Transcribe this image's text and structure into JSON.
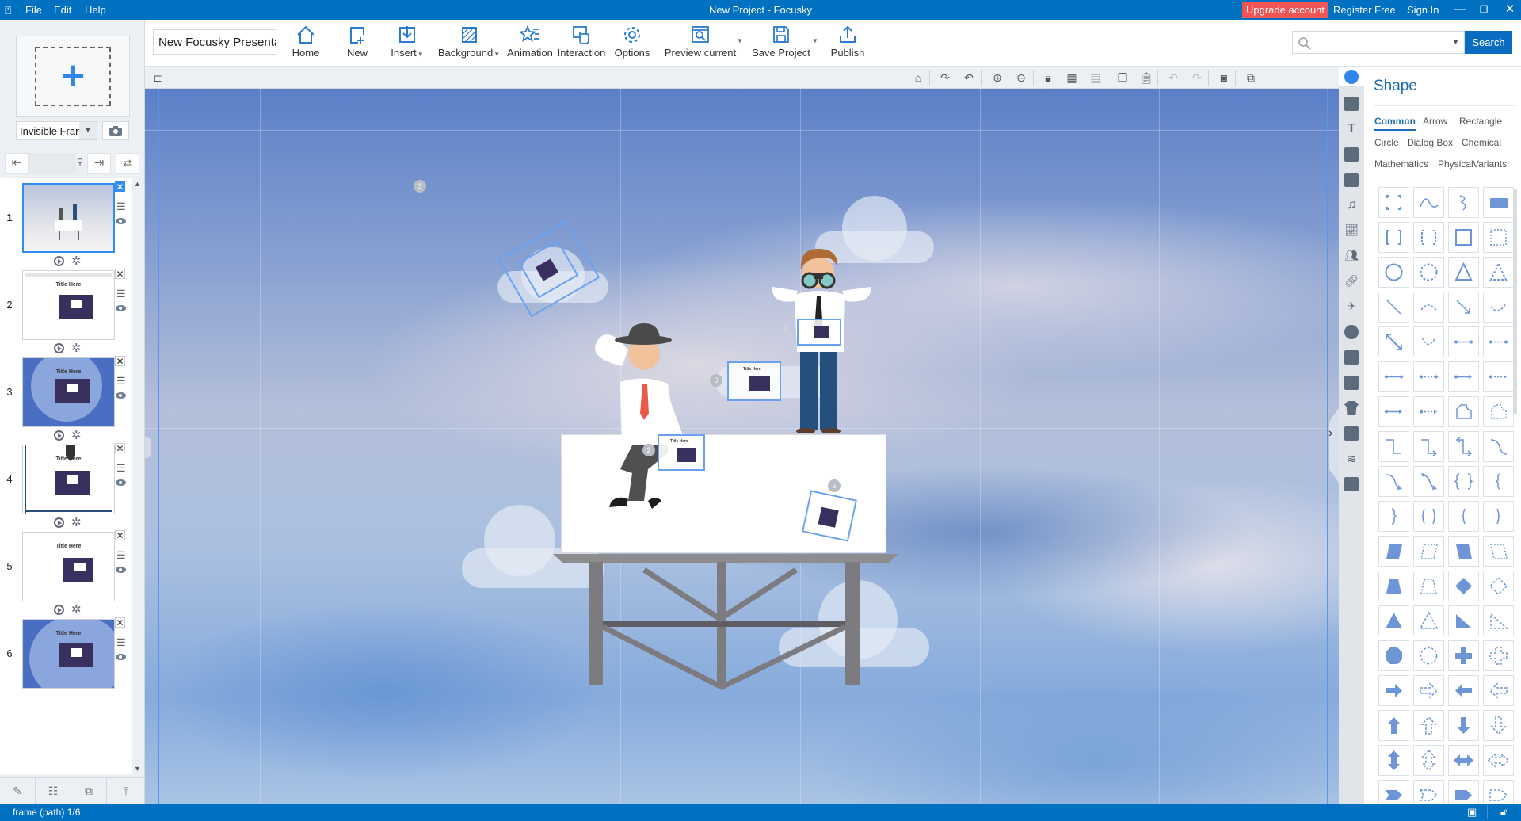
{
  "titlebar": {
    "app_icon": "presentation-icon",
    "menus": [
      "File",
      "Edit",
      "Help"
    ],
    "title": "New Project - Focusky",
    "upgrade": "Upgrade account",
    "register": "Register Free",
    "signin": "Sign In",
    "window_controls": [
      "minimize-icon",
      "restore-icon",
      "close-icon"
    ]
  },
  "toolbar": {
    "project_name": "New Focusky Presenta",
    "buttons": [
      {
        "label": "Home",
        "icon": "home-icon"
      },
      {
        "label": "New",
        "icon": "new-page-icon"
      },
      {
        "label": "Insert",
        "icon": "insert-icon",
        "dropdown": true
      },
      {
        "label": "Background",
        "icon": "background-icon",
        "dropdown": true
      },
      {
        "label": "Animation",
        "icon": "animation-star-icon"
      },
      {
        "label": "Interaction",
        "icon": "interaction-hand-icon"
      },
      {
        "label": "Options",
        "icon": "gear-icon"
      },
      {
        "label": "Preview current",
        "icon": "preview-icon",
        "dropdown": true
      },
      {
        "label": "Save Project",
        "icon": "save-icon",
        "dropdown": true
      },
      {
        "label": "Publish",
        "icon": "publish-icon"
      }
    ],
    "search_placeholder": "",
    "search_button": "Search"
  },
  "left_panel": {
    "add_frame_symbol": "+",
    "frame_type": "Invisible Fran",
    "frames": [
      {
        "number": "1",
        "title": "",
        "selected": true,
        "theme": "scene"
      },
      {
        "number": "2",
        "title": "Title Here",
        "selected": false,
        "theme": "white"
      },
      {
        "number": "3",
        "title": "Title Here",
        "selected": false,
        "theme": "blue"
      },
      {
        "number": "4",
        "title": "Title Here",
        "selected": false,
        "theme": "white-arrow"
      },
      {
        "number": "5",
        "title": "Title Here",
        "selected": false,
        "theme": "white"
      },
      {
        "number": "6",
        "title": "Title Here",
        "selected": false,
        "theme": "blue"
      }
    ]
  },
  "canvas": {
    "markers": [
      "3",
      "1",
      "6",
      "2",
      "5"
    ],
    "frame_title": "Title Here"
  },
  "shape_panel": {
    "title": "Shape",
    "categories": [
      "Common",
      "Arrow",
      "Rectangle",
      "Circle",
      "Dialog Box",
      "Chemical",
      "Mathematics",
      "Physical",
      "Variants"
    ],
    "active_category": "Common"
  },
  "statusbar": {
    "text": "frame (path) 1/6"
  }
}
